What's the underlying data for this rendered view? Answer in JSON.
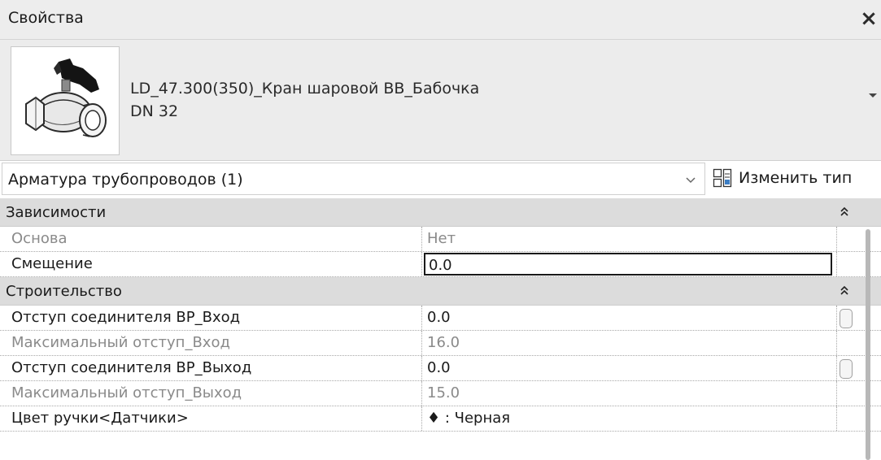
{
  "window": {
    "title": "Свойства",
    "close_symbol": "×"
  },
  "type_selector": {
    "family_name": "LD_47.300(350)_Кран шаровой ВВ_Бабочка",
    "type_name": "DN 32",
    "thumbnail_icon": "ball-valve-butterfly-handle-icon"
  },
  "filter": {
    "category": "Арматура трубопроводов (1)",
    "edit_type_label": "Изменить тип",
    "edit_type_icon": "edit-type-icon"
  },
  "groups": [
    {
      "label": "Зависимости",
      "properties": [
        {
          "name": "Основа",
          "value": "Нет",
          "readonly": true
        },
        {
          "name": "Смещение",
          "value": "0.0",
          "readonly": false,
          "editing": true
        }
      ]
    },
    {
      "label": "Строительство",
      "properties": [
        {
          "name": "Отступ соединителя ВР_Вход",
          "value": "0.0",
          "readonly": false
        },
        {
          "name": "Максимальный отступ_Вход",
          "value": "16.0",
          "readonly": true
        },
        {
          "name": "Отступ соединителя ВР_Выход",
          "value": "0.0",
          "readonly": false
        },
        {
          "name": "Максимальный отступ_Выход",
          "value": "15.0",
          "readonly": true
        },
        {
          "name": "Цвет ручки<Датчики>",
          "value": "♦ : Черная",
          "readonly": false
        }
      ]
    }
  ]
}
